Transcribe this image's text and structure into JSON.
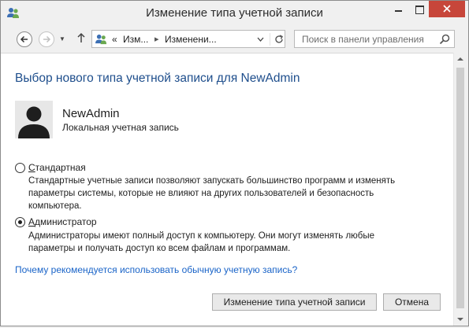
{
  "window": {
    "title": "Изменение типа учетной записи"
  },
  "nav": {
    "breadcrumb_prefix": "«",
    "crumb1": "Изм...",
    "crumb2": "Изменени...",
    "search_placeholder": "Поиск в панели управления"
  },
  "content": {
    "heading": "Выбор нового типа учетной записи для NewAdmin",
    "user": {
      "name": "NewAdmin",
      "type": "Локальная учетная запись"
    },
    "options": [
      {
        "label_underlined": "С",
        "label_rest": "тандартная",
        "selected": false,
        "description": "Стандартные учетные записи позволяют запускать большинство программ и изменять параметры системы, которые не влияют на других пользователей и безопасность компьютера."
      },
      {
        "label_underlined": "А",
        "label_rest": "дминистратор",
        "selected": true,
        "description": "Администраторы имеют полный доступ к компьютеру. Они могут изменять любые параметры и получать доступ ко всем файлам и программам."
      }
    ],
    "link": "Почему рекомендуется использовать обычную учетную запись?",
    "buttons": {
      "change": "Изменение типа учетной записи",
      "cancel": "Отмена"
    }
  },
  "colors": {
    "heading": "#1e4e8c",
    "link": "#1a64c8",
    "close_button": "#c7463a"
  }
}
